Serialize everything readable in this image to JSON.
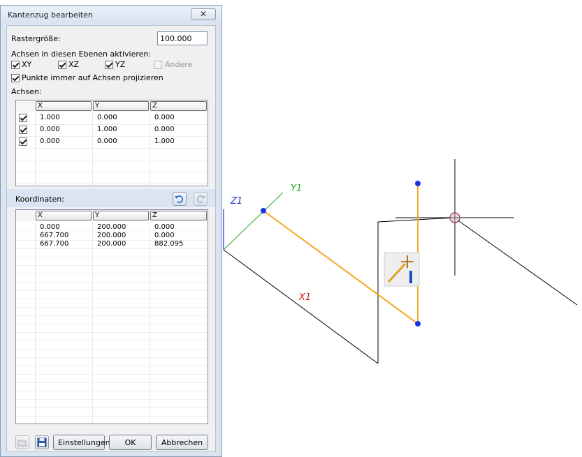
{
  "dialog": {
    "title": "Kantenzug bearbeiten",
    "close_label": "✕",
    "grid_size_label": "Rastergröße:",
    "grid_size_value": "100.000",
    "axes_planes_label": "Achsen in diesen Ebenen aktivieren:",
    "planes": [
      {
        "label": "XY",
        "checked": true
      },
      {
        "label": "XZ",
        "checked": true
      },
      {
        "label": "YZ",
        "checked": true
      },
      {
        "label": "Andere",
        "checked": false,
        "disabled": true
      }
    ],
    "project_label": "Punkte immer auf Achsen projizieren",
    "axes_label": "Achsen:",
    "axes_columns": [
      "X",
      "Y",
      "Z"
    ],
    "axes_rows": [
      {
        "x": "1.000",
        "y": "0.000",
        "z": "0.000"
      },
      {
        "x": "0.000",
        "y": "1.000",
        "z": "0.000"
      },
      {
        "x": "0.000",
        "y": "0.000",
        "z": "1.000"
      }
    ],
    "coords_label": "Koordinaten:",
    "coords_columns": [
      "X",
      "Y",
      "Z"
    ],
    "coords_rows": [
      {
        "x": "0.000",
        "y": "200.000",
        "z": "0.000"
      },
      {
        "x": "667.700",
        "y": "200.000",
        "z": "0.000"
      },
      {
        "x": "667.700",
        "y": "200.000",
        "z": "882.095"
      }
    ],
    "buttons": {
      "settings": "Einstellungen",
      "ok": "OK",
      "cancel": "Abbrechen"
    }
  },
  "drawing": {
    "axis_labels": {
      "x": "X1",
      "y": "Y1",
      "z": "Z1"
    },
    "colors": {
      "polyline": "#f5a623",
      "point": "#1a33e6",
      "x_axis": "#cc2222",
      "y_axis": "#22aa22",
      "z_axis": "#2233cc"
    }
  }
}
